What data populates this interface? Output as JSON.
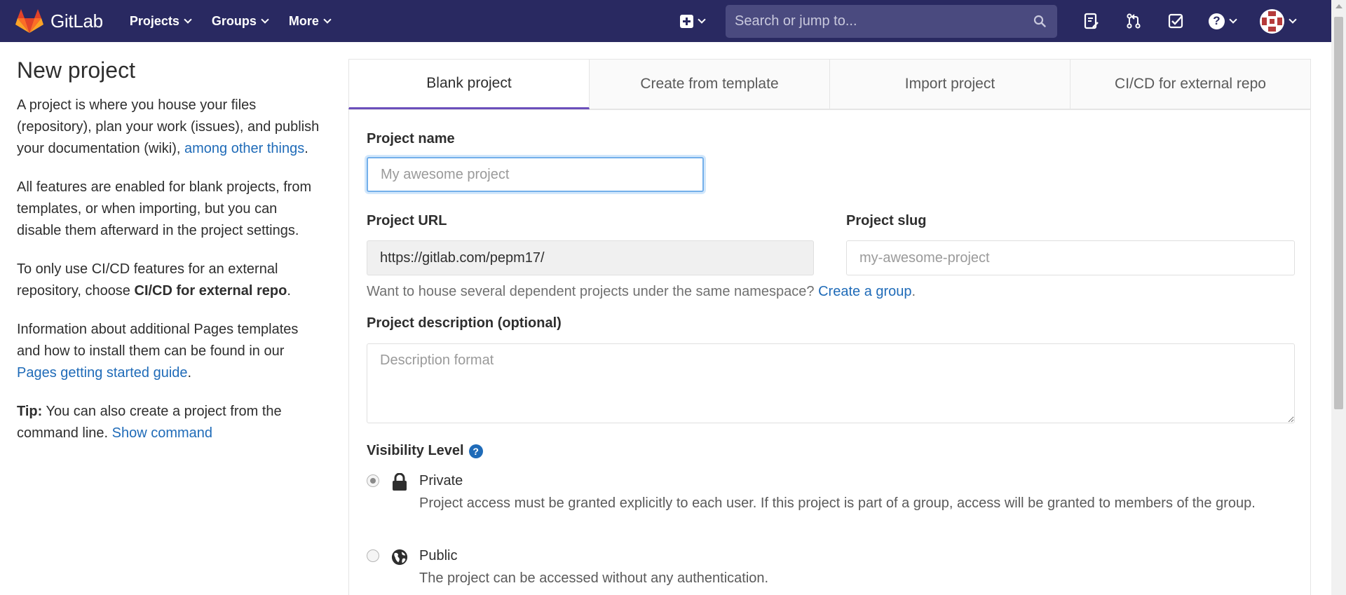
{
  "navbar": {
    "brand": "GitLab",
    "menu": [
      {
        "label": "Projects"
      },
      {
        "label": "Groups"
      },
      {
        "label": "More"
      }
    ],
    "search_placeholder": "Search or jump to...",
    "icons": [
      "plus-square-icon",
      "search-icon",
      "issues-icon",
      "merge-request-icon",
      "todo-check-icon",
      "help-icon",
      "avatar"
    ],
    "colors": {
      "navbar_bg": "#292961",
      "search_bg": "#4a4a7f",
      "link": "#1f6bb8",
      "active_tab": "#6b4fbb"
    }
  },
  "sidebar": {
    "title": "New project",
    "intro_text": "A project is where you house your files (repository), plan your work (issues), and publish your documentation (wiki), ",
    "intro_link": "among other things",
    "features_text": "All features are enabled for blank projects, from templates, or when importing, but you can disable them afterward in the project settings.",
    "cicd_text": "To only use CI/CD features for an external repository, choose ",
    "cicd_bold": "CI/CD for external repo",
    "pages_text": "Information about additional Pages templates and how to install them can be found in our ",
    "pages_link": "Pages getting started guide",
    "tip_bold": "Tip:",
    "tip_text": " You can also create a project from the command line. ",
    "tip_link": "Show command",
    "period": "."
  },
  "tabs": [
    {
      "label": "Blank project",
      "active": true
    },
    {
      "label": "Create from template",
      "active": false
    },
    {
      "label": "Import project",
      "active": false
    },
    {
      "label": "CI/CD for external repo",
      "active": false
    }
  ],
  "form": {
    "project_name_label": "Project name",
    "project_name_placeholder": "My awesome project",
    "project_url_label": "Project URL",
    "project_url_value": "https://gitlab.com/pepm17/",
    "project_slug_label": "Project slug",
    "project_slug_placeholder": "my-awesome-project",
    "namespace_help": "Want to house several dependent projects under the same namespace? ",
    "namespace_link": "Create a group",
    "description_label": "Project description (optional)",
    "description_placeholder": "Description format",
    "visibility_label": "Visibility Level",
    "visibility_help_glyph": "?",
    "visibility_options": [
      {
        "title": "Private",
        "description": "Project access must be granted explicitly to each user. If this project is part of a group, access will be granted to members of the group.",
        "checked": true,
        "icon": "lock-icon"
      },
      {
        "title": "Public",
        "description": "The project can be accessed without any authentication.",
        "checked": false,
        "icon": "globe-icon"
      }
    ]
  }
}
